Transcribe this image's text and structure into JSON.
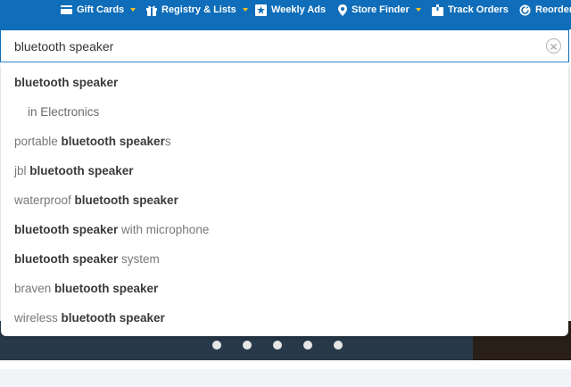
{
  "nav": {
    "items": [
      {
        "label": "Gift Cards",
        "icon": "gift-card-icon",
        "has_dropdown": true
      },
      {
        "label": "Registry & Lists",
        "icon": "gift-icon",
        "has_dropdown": true
      },
      {
        "label": "Weekly Ads",
        "icon": "weekly-ad-icon",
        "has_dropdown": false
      },
      {
        "label": "Store Finder",
        "icon": "location-pin-icon",
        "has_dropdown": true
      },
      {
        "label": "Track Orders",
        "icon": "package-icon",
        "has_dropdown": false
      },
      {
        "label": "Reorder",
        "icon": "reorder-icon",
        "has_dropdown": false
      }
    ]
  },
  "search": {
    "value": "bluetooth speaker"
  },
  "suggestions": [
    {
      "pre": "",
      "bold": "bluetooth speaker",
      "post": ""
    },
    {
      "pre": "in Electronics",
      "bold": "",
      "post": "",
      "sub": true
    },
    {
      "pre": "portable ",
      "bold": "bluetooth speaker",
      "post": "s"
    },
    {
      "pre": "jbl ",
      "bold": "bluetooth speaker",
      "post": ""
    },
    {
      "pre": "waterproof ",
      "bold": "bluetooth speaker",
      "post": ""
    },
    {
      "pre": "",
      "bold": "bluetooth speaker",
      "post": " with microphone"
    },
    {
      "pre": "",
      "bold": "bluetooth speaker",
      "post": " system"
    },
    {
      "pre": "braven ",
      "bold": "bluetooth speaker",
      "post": ""
    },
    {
      "pre": "wireless ",
      "bold": "bluetooth speaker",
      "post": ""
    }
  ],
  "carousel": {
    "slide_count": 5
  },
  "colors": {
    "brand_blue": "#0f6db9",
    "accent_yellow": "#ffc220"
  }
}
